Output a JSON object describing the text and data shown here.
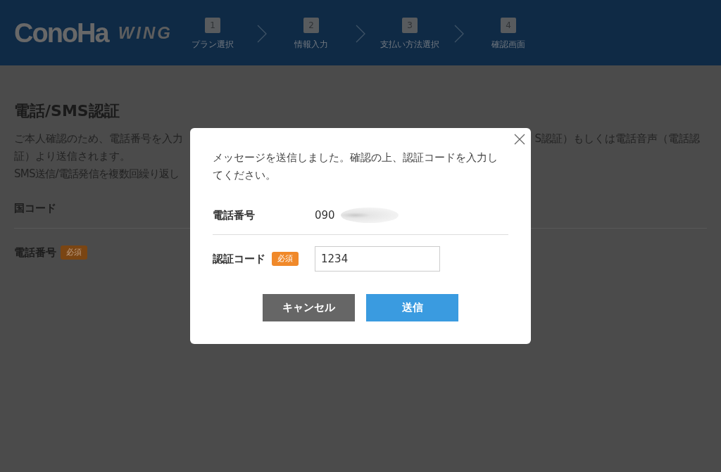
{
  "header": {
    "logo": {
      "brand": "ConoHa",
      "product": "WING"
    },
    "steps": [
      {
        "number": "1",
        "label": "プラン選択"
      },
      {
        "number": "2",
        "label": "情報入力"
      },
      {
        "number": "3",
        "label": "支払い方法選択"
      },
      {
        "number": "4",
        "label": "確認画面"
      }
    ]
  },
  "page": {
    "title": "電話/SMS認証",
    "description_lines": [
      [
        "ご本人確認のため、電話番号を入力",
        "S認証）もしくは電話音声（電話認"
      ],
      [
        "証）より送信されます。"
      ],
      [
        "SMS送信/電話発信を複数回繰り返し"
      ]
    ],
    "fields": [
      {
        "label": "国コード"
      },
      {
        "label": "電話番号",
        "badge": "必須"
      }
    ]
  },
  "dialog": {
    "message": "メッセージを送信しました。確認の上、認証コードを入力してください。",
    "rows": [
      {
        "kind": "value",
        "label": "電話番号",
        "value": "090",
        "redacted": true
      },
      {
        "kind": "input",
        "label": "認証コード",
        "badge": "必須",
        "value": "1234"
      }
    ],
    "buttons": [
      {
        "kind": "secondary",
        "label": "キャンセル"
      },
      {
        "kind": "primary",
        "label": "送信"
      }
    ]
  }
}
